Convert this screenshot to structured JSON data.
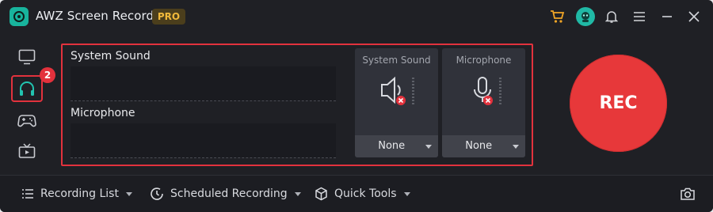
{
  "app": {
    "title": "AWZ Screen Recorder",
    "badge": "PRO"
  },
  "nav": {
    "badge_count": "2"
  },
  "audio": {
    "system_sound_label": "System Sound",
    "microphone_label": "Microphone",
    "cards": [
      {
        "title": "System Sound",
        "value": "None",
        "icon": "speaker-muted-icon"
      },
      {
        "title": "Microphone",
        "value": "None",
        "icon": "microphone-muted-icon"
      }
    ]
  },
  "rec": {
    "label": "REC"
  },
  "bottom": {
    "recording_list": "Recording List",
    "scheduled_recording": "Scheduled Recording",
    "quick_tools": "Quick Tools"
  },
  "colors": {
    "accent": "#e7383a",
    "background": "#1f2025",
    "teal": "#18b49d",
    "pro": "#f1b93b"
  }
}
